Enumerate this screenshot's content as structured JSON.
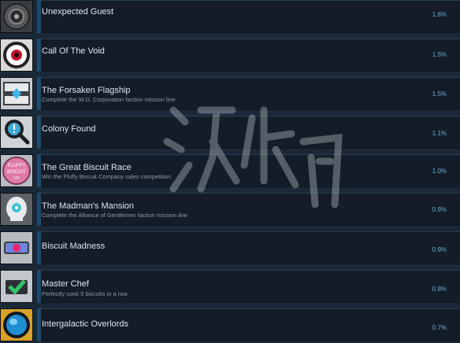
{
  "achievements": [
    {
      "name": "Unexpected Guest",
      "description": "",
      "percent": "1.6%",
      "icon": "wheel-icon"
    },
    {
      "name": "Call Of The Void",
      "description": "",
      "percent": "1.5%",
      "icon": "void-eye-icon"
    },
    {
      "name": "The Forsaken Flagship",
      "description": "Complete the W.D. Corporation faction mission line",
      "percent": "1.5%",
      "icon": "flagship-icon"
    },
    {
      "name": "Colony Found",
      "description": "",
      "percent": "1.1%",
      "icon": "magnifier-icon"
    },
    {
      "name": "The Great Biscuit Race",
      "description": "Win the Fluffy Biscuit Company sales competition",
      "percent": "1.0%",
      "icon": "fluffy-biscuit-badge-icon"
    },
    {
      "name": "The Madman's Mansion",
      "description": "Complete the Alliance of Gentlemen faction mission line",
      "percent": "0.9%",
      "icon": "alien-skull-icon"
    },
    {
      "name": "Biscuit Madness",
      "description": "",
      "percent": "0.9%",
      "icon": "pink-orb-icon"
    },
    {
      "name": "Master Chef",
      "description": "Perfectly cook 5 biscuits in a row",
      "percent": "0.8%",
      "icon": "checkmark-icon"
    },
    {
      "name": "Intergalactic Overlords",
      "description": "",
      "percent": "0.7%",
      "icon": "blue-planet-icon"
    }
  ],
  "icon_badge_text": {
    "line1": "FLUFFY",
    "line2": "BISCUIT",
    "line3": "CO"
  },
  "watermark_text": "游侠网",
  "colors": {
    "background": "#1b2838",
    "row_panel": "#141d27",
    "accent_bar": "#1f4a6e",
    "title_text": "#dde4ec",
    "description_text": "#8f98a0",
    "percent_text": "#6aa9dc"
  }
}
